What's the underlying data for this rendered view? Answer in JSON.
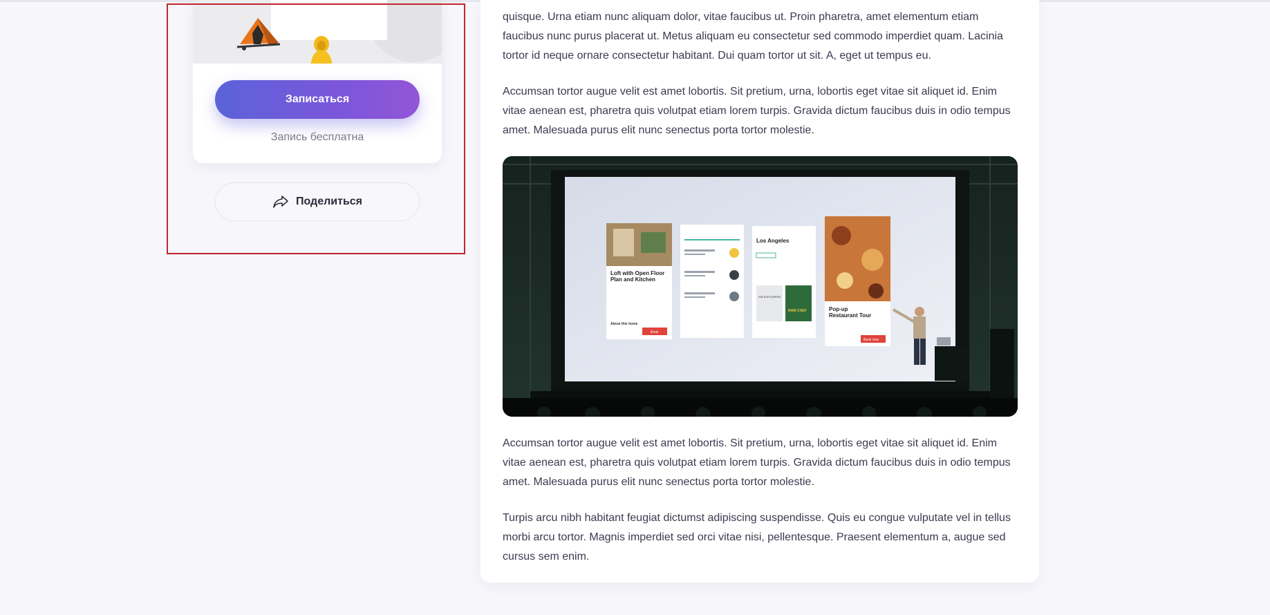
{
  "sidebar": {
    "enroll_label": "Записаться",
    "free_note": "Запись бесплатна",
    "share_label": "Поделиться"
  },
  "article": {
    "paragraphs": [
      "quisque. Urna etiam nunc aliquam dolor, vitae faucibus ut. Proin pharetra, amet elementum etiam faucibus nunc purus placerat ut. Metus aliquam eu consectetur sed commodo imperdiet quam. Lacinia tortor id neque ornare consectetur habitant. Dui quam tortor ut sit. A, eget ut tempus eu.",
      "Accumsan tortor augue velit est amet lobortis. Sit pretium, urna, lobortis eget vitae sit aliquet id. Enim vitae aenean est, pharetra quis volutpat etiam lorem turpis. Gravida dictum faucibus duis in odio tempus amet. Malesuada purus elit nunc senectus porta tortor molestie.",
      "Accumsan tortor augue velit est amet lobortis. Sit pretium, urna, lobortis eget vitae sit aliquet id. Enim vitae aenean est, pharetra quis volutpat etiam lorem turpis. Gravida dictum faucibus duis in odio tempus amet. Malesuada purus elit nunc senectus porta tortor molestie.",
      "Turpis arcu nibh habitant feugiat dictumst adipiscing suspendisse. Quis eu congue vulputate vel in tellus morbi arcu tortor. Magnis imperdiet sed orci vitae nisi, pellentesque. Praesent elementum a, augue sed cursus sem enim."
    ],
    "slide": {
      "card1_title": "Loft with Open Floor Plan and Kitchen",
      "card1_section": "About this home",
      "card1_button": "Book",
      "card3_title": "Los Angeles",
      "card3_book1": "ISN EXPLORERS",
      "card3_book2": "RAW CHEF",
      "card4_title": "Pop-up Restaurant Tour",
      "card4_button": "Book now"
    }
  },
  "colors": {
    "accent_start": "#5b63d9",
    "accent_end": "#9356d6",
    "background": "#f6f6fb",
    "highlight_border": "#c0262d"
  },
  "icons": [
    "share-icon"
  ]
}
